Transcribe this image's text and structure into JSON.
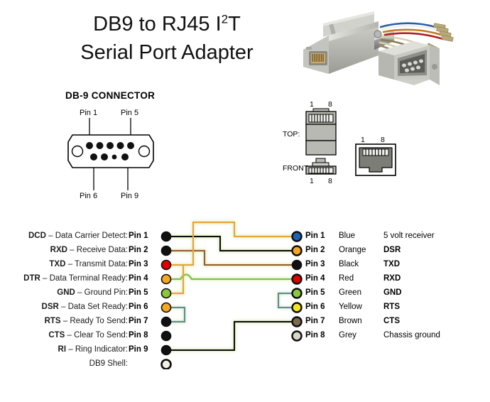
{
  "title": {
    "line1_a": "DB9 to RJ45 I",
    "line1_sup": "2",
    "line1_b": "T",
    "line2": "Serial Port Adapter"
  },
  "db9_diagram": {
    "heading": "DB-9 CONNECTOR",
    "label_top_left": "Pin 1",
    "label_top_right": "Pin 5",
    "label_bottom_left": "Pin 6",
    "label_bottom_right": "Pin 9"
  },
  "rj45_diagram": {
    "top_label": "TOP:",
    "front_label": "FRONT:",
    "top_pin_low": "1",
    "top_pin_high": "8",
    "front_pin_low": "1",
    "front_pin_high": "8",
    "face_pin_low": "1",
    "face_pin_high": "8"
  },
  "pinout": {
    "db9_rows": [
      {
        "signal": "DCD",
        "dash": "–",
        "desc": "Data Carrier Detect:",
        "pin": "Pin 1",
        "dot": "#111111",
        "hollow": false
      },
      {
        "signal": "RXD",
        "dash": "–",
        "desc": "Receive Data:",
        "pin": "Pin 2",
        "dot": "#111111",
        "hollow": false
      },
      {
        "signal": "TXD",
        "dash": "–",
        "desc": "Transmit Data:",
        "pin": "Pin 3",
        "dot": "#e00000",
        "hollow": false
      },
      {
        "signal": "DTR",
        "dash": "–",
        "desc": "Data Terminal Ready:",
        "pin": "Pin 4",
        "dot": "#f5a623",
        "hollow": false
      },
      {
        "signal": "GND",
        "dash": "–",
        "desc": "Ground Pin:",
        "pin": "Pin 5",
        "dot": "#8cc63f",
        "hollow": false
      },
      {
        "signal": "DSR",
        "dash": "–",
        "desc": "Data Set Ready:",
        "pin": "Pin 6",
        "dot": "#f5a623",
        "hollow": false
      },
      {
        "signal": "RTS",
        "dash": "–",
        "desc": "Ready To Send:",
        "pin": "Pin 7",
        "dot": "#111111",
        "hollow": false
      },
      {
        "signal": "CTS",
        "dash": "–",
        "desc": "Clear To Send:",
        "pin": "Pin 8",
        "dot": "#111111",
        "hollow": false
      },
      {
        "signal": "RI",
        "dash": "–",
        "desc": "Ring Indicator:",
        "pin": "Pin 9",
        "dot": "#111111",
        "hollow": false
      },
      {
        "signal": "",
        "dash": "",
        "desc": "DB9 Shell:",
        "pin": "",
        "dot": "#f2f0e6",
        "hollow": true
      }
    ],
    "rj45_rows": [
      {
        "pin": "Pin 1",
        "color_name": "Blue",
        "dot": "#1b63b5",
        "function": "5 volt receiver",
        "bold": false
      },
      {
        "pin": "Pin 2",
        "color_name": "Orange",
        "dot": "#f5a623",
        "function": "DSR",
        "bold": true
      },
      {
        "pin": "Pin 3",
        "color_name": "Black",
        "dot": "#111111",
        "function": "TXD",
        "bold": true
      },
      {
        "pin": "Pin 4",
        "color_name": "Red",
        "dot": "#e00000",
        "function": "RXD",
        "bold": true
      },
      {
        "pin": "Pin 5",
        "color_name": "Green",
        "dot": "#8cc63f",
        "function": "GND",
        "bold": true
      },
      {
        "pin": "Pin 6",
        "color_name": "Yellow",
        "dot": "#f5e619",
        "function": "RTS",
        "bold": true
      },
      {
        "pin": "Pin 7",
        "color_name": "Brown",
        "dot": "#7a6a4f",
        "function": "CTS",
        "bold": true
      },
      {
        "pin": "Pin 8",
        "color_name": "Grey",
        "dot": "#d9d6cc",
        "function": "Chassis ground",
        "bold": false
      }
    ],
    "wire_colors": {
      "black": "#0d0d0d",
      "orange": "#e8a33d",
      "brown": "#9c5a2d",
      "green": "#7cc04a",
      "bluegrey": "#5f89a6",
      "shell": "#0d0d0d",
      "glow": "#e8f5c8"
    }
  },
  "connections": [
    {
      "from": "DB9 Pin 2 RXD",
      "to": "RJ45 Pin 3 Black TXD",
      "wire": "black"
    },
    {
      "from": "DB9 Pin 3 TXD",
      "to": "RJ45 Pin 4 Red RXD",
      "wire": "brown"
    },
    {
      "from": "DB9 Pin 4 DTR",
      "to": "RJ45 Pin 2 Orange DSR",
      "wire": "orange"
    },
    {
      "from": "DB9 Pin 5 GND",
      "to": "RJ45 Pin 5 Green GND",
      "wire": "green"
    },
    {
      "from": "DB9 Pin 6 DSR",
      "to": "DB9 Pin 4 DTR",
      "wire": "orange"
    },
    {
      "from": "DB9 Pin 7 RTS",
      "to": "DB9 Pin 8 CTS",
      "wire": "bluegrey"
    },
    {
      "from": "RJ45 Pin 6 Yellow RTS",
      "to": "RJ45 Pin 7 Brown CTS",
      "wire": "bluegrey"
    },
    {
      "from": "DB9 Shell",
      "to": "RJ45 Pin 8 Grey Chassis ground",
      "wire": "black"
    }
  ]
}
